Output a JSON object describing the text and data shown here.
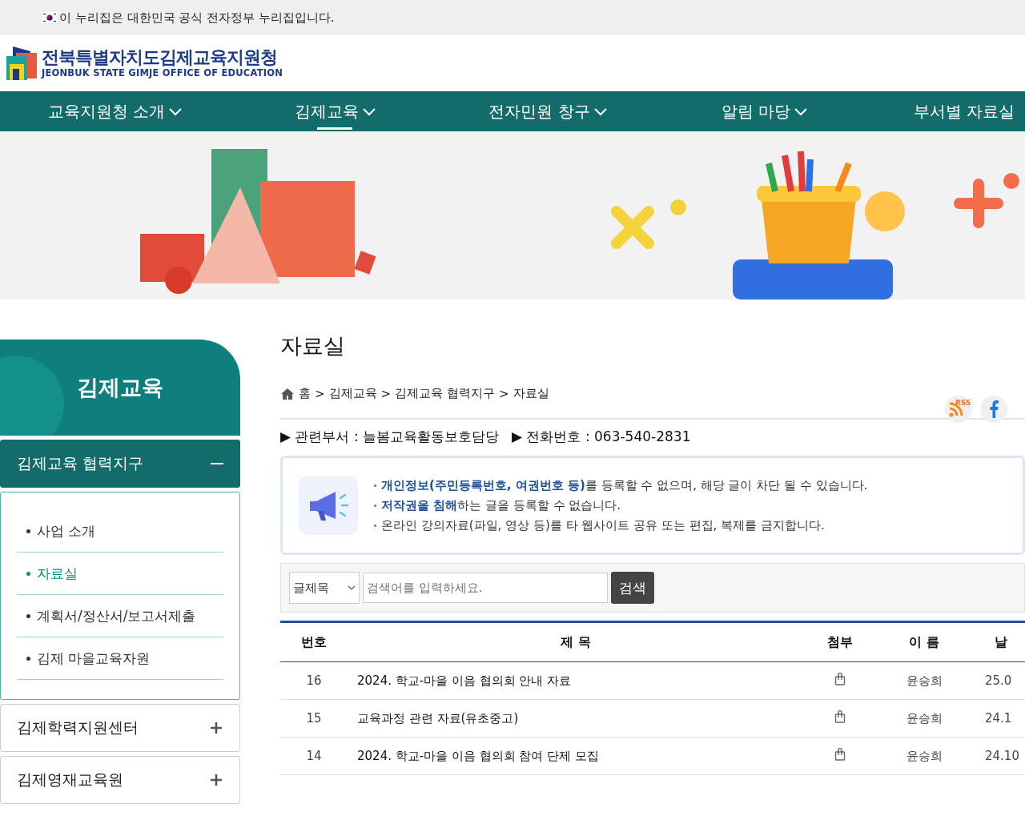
{
  "gov_bar": {
    "text": "이 누리집은 대한민국 공식 전자정부 누리집입니다."
  },
  "logo": {
    "title": "전북특별자치도김제교육지원청",
    "subtitle": "JEONBUK STATE GIMJE OFFICE OF EDUCATION"
  },
  "nav": [
    {
      "label": "교육지원청 소개",
      "selected": false
    },
    {
      "label": "김제교육",
      "selected": true
    },
    {
      "label": "전자민원 창구",
      "selected": false
    },
    {
      "label": "알림 마당",
      "selected": false
    },
    {
      "label": "부서별 자료실",
      "selected": false
    }
  ],
  "sidebar": {
    "title": "김제교육",
    "groups": [
      {
        "label": "김제교육 협력지구",
        "expanded": true,
        "children": [
          {
            "label": "사업 소개",
            "selected": false
          },
          {
            "label": "자료실",
            "selected": true
          },
          {
            "label": "계획서/정산서/보고서제출",
            "selected": false
          },
          {
            "label": "김제 마을교육자원",
            "selected": false
          }
        ]
      },
      {
        "label": "김제학력지원센터",
        "expanded": false
      },
      {
        "label": "김제영재교육원",
        "expanded": false
      }
    ]
  },
  "page": {
    "title": "자료실",
    "breadcrumb": [
      "홈",
      "김제교육",
      "김제교육 협력지구",
      "자료실"
    ],
    "breadcrumb_separator": ">",
    "rss_label": "RSS"
  },
  "info": [
    "▶ 관련부서 : 늘봄교육활동보호담당",
    "▶ 전화번호 : 063-540-2831"
  ],
  "notice": [
    "**개인정보(주민등록번호, 여권번호 등)**를 등록할 수 없으며, 해당 글이 차단 될 수 있습니다.",
    "**저작권을 침해**하는 글을 등록할 수 없습니다.",
    "온라인 강의자료(파일, 영상 등)를 타 웹사이트 공유 또는 편집, 복제를 금지합니다."
  ],
  "search": {
    "select_value": "글제목",
    "placeholder": "검색어를 입력하세요.",
    "button": "검색"
  },
  "table": {
    "columns": [
      "번호",
      "제 목",
      "첨부",
      "이 름",
      "날"
    ],
    "rows": [
      {
        "number": "16",
        "title": "2024. 학교-마을 이음 협의회 안내 자료",
        "attachment": true,
        "name": "윤승희",
        "date": "25.0"
      },
      {
        "number": "15",
        "title": "교육과정 관련 자료(유초중고)",
        "attachment": true,
        "name": "윤승희",
        "date": "24.1"
      },
      {
        "number": "14",
        "title": "2024. 학교-마을 이음 협의회 참여 단제 모집",
        "attachment": true,
        "name": "윤승희",
        "date": "24.10"
      }
    ]
  }
}
